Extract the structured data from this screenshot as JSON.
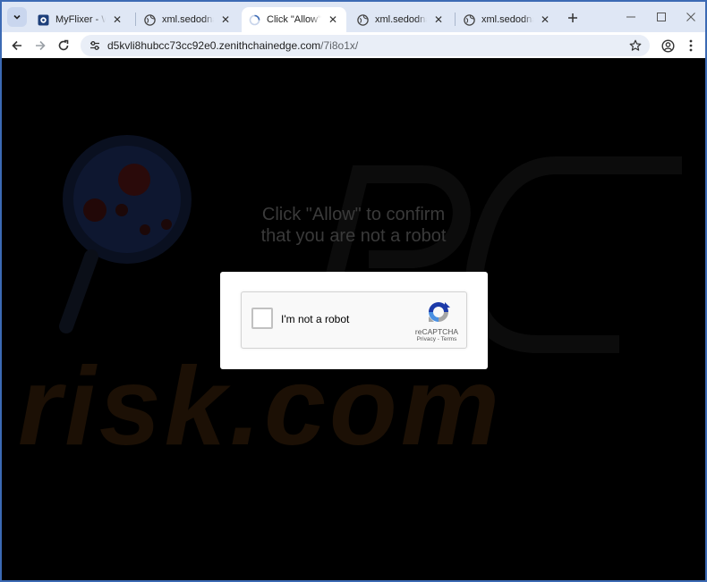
{
  "tabs": [
    {
      "title": "MyFlixer - Watch Movies",
      "favicon": "myflixer-icon",
      "active": false
    },
    {
      "title": "xml.sedodna.com",
      "favicon": "globe-icon",
      "active": false
    },
    {
      "title": "Click \"Allow\"",
      "favicon": "loading-icon",
      "active": true
    },
    {
      "title": "xml.sedodna.com",
      "favicon": "globe-icon",
      "active": false
    },
    {
      "title": "xml.sedodna.com",
      "favicon": "globe-icon",
      "active": false
    }
  ],
  "address_bar": {
    "host": "d5kvli8hubcc73cc92e0.zenithchainedge.com",
    "path": "/7i8o1x/"
  },
  "content": {
    "headline_line1": "Click \"Allow\" to confirm",
    "headline_line2": "that you are not a robot",
    "recaptcha": {
      "label": "I'm not a robot",
      "brand": "reCAPTCHA",
      "privacy": "Privacy",
      "separator": " - ",
      "terms": "Terms"
    },
    "watermark": "risk.com"
  },
  "colors": {
    "window_frame": "#3c6ab4",
    "tabstrip_bg": "#dfe7f5",
    "page_bg": "#000000",
    "headline": "#3a3a3a"
  }
}
